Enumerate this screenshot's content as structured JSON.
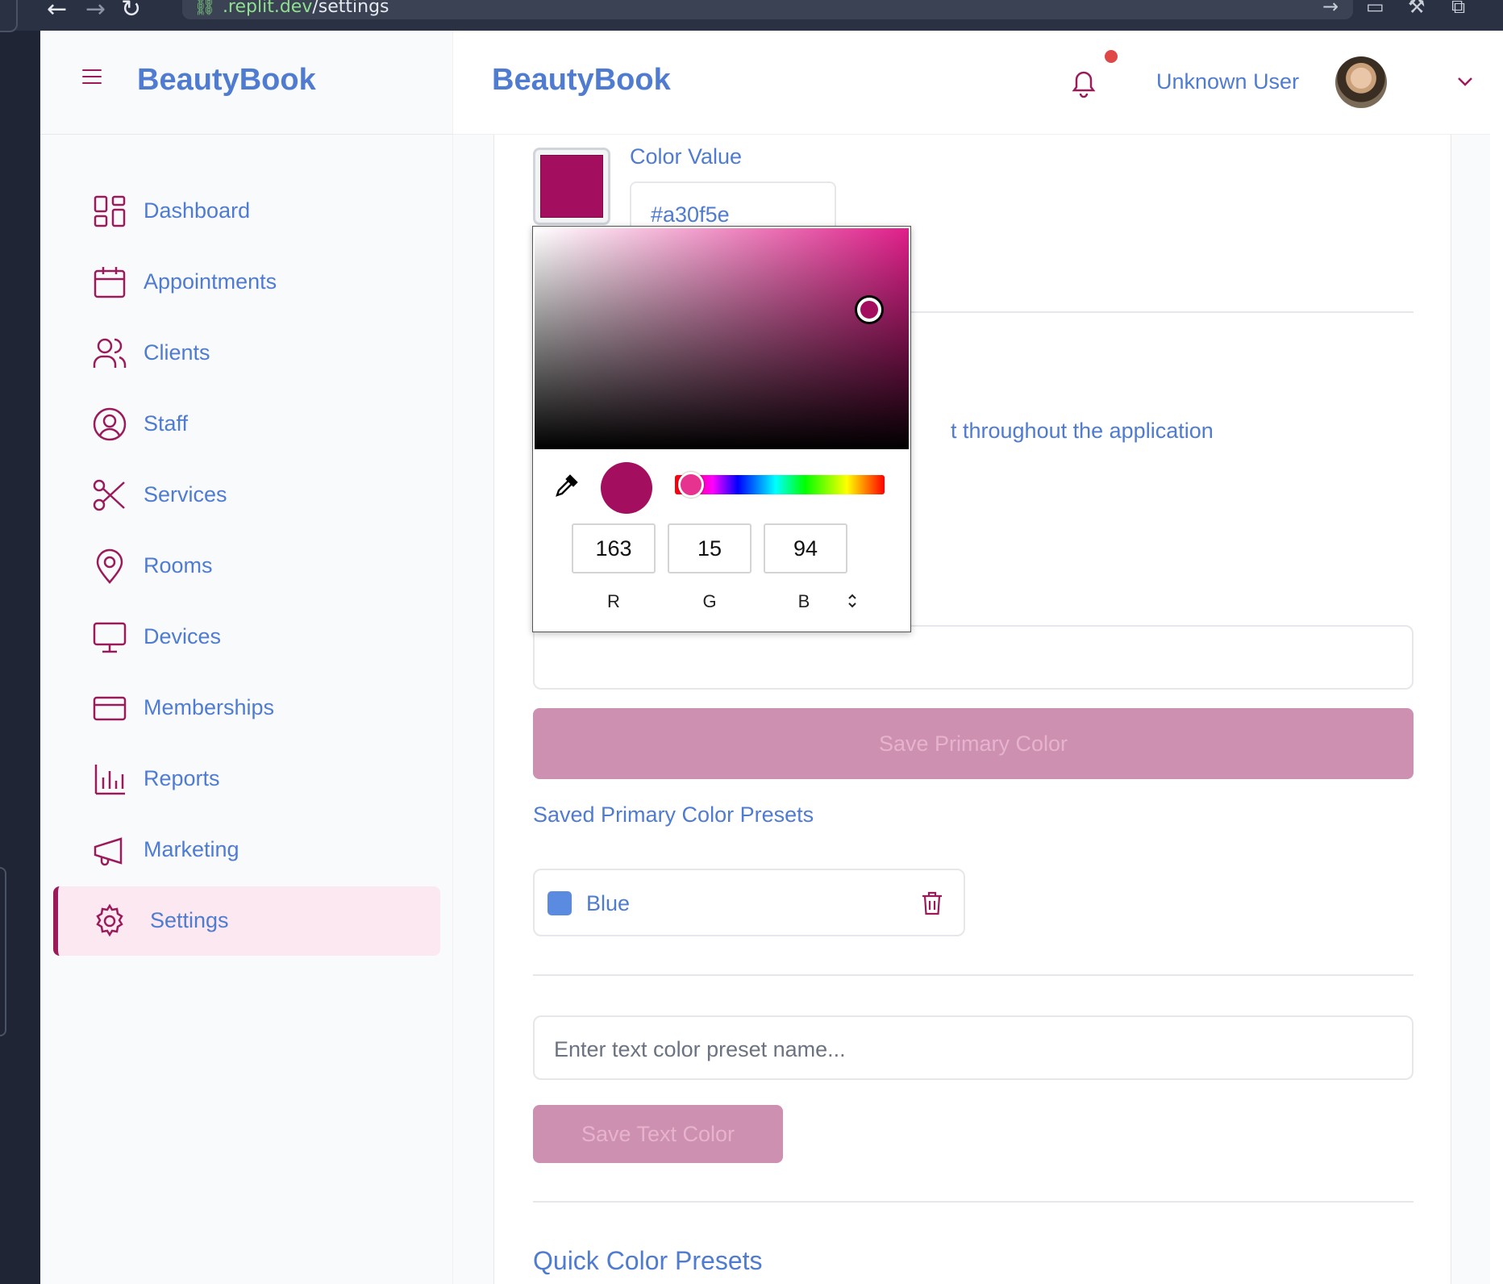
{
  "browser": {
    "url_host": ".replit.dev",
    "url_path": "/settings"
  },
  "sidebar": {
    "brand": "BeautyBook",
    "items": [
      {
        "label": "Dashboard",
        "icon": "dashboard-icon"
      },
      {
        "label": "Appointments",
        "icon": "calendar-icon"
      },
      {
        "label": "Clients",
        "icon": "users-icon"
      },
      {
        "label": "Staff",
        "icon": "user-circle-icon"
      },
      {
        "label": "Services",
        "icon": "scissors-icon"
      },
      {
        "label": "Rooms",
        "icon": "map-pin-icon"
      },
      {
        "label": "Devices",
        "icon": "monitor-icon"
      },
      {
        "label": "Memberships",
        "icon": "credit-card-icon"
      },
      {
        "label": "Reports",
        "icon": "bar-chart-icon"
      },
      {
        "label": "Marketing",
        "icon": "megaphone-icon"
      },
      {
        "label": "Settings",
        "icon": "gear-icon",
        "active": true
      }
    ]
  },
  "header": {
    "brand": "BeautyBook",
    "username": "Unknown User",
    "has_notification": true
  },
  "settings": {
    "color_value_label": "Color Value",
    "color_value": "#a30f5e",
    "description_visible": "t throughout the application",
    "save_primary_label": "Save Primary Color",
    "saved_presets_title": "Saved Primary Color Presets",
    "presets": [
      {
        "name": "Blue",
        "color": "#5b8be0"
      }
    ],
    "text_preset_placeholder": "Enter text color preset name...",
    "save_text_label": "Save Text Color",
    "quick_presets_title": "Quick Color Presets",
    "quick_presets": [
      "#5b8be0",
      "#8b5cf6",
      "#ec4899",
      "#10b981",
      "#9b1b5a",
      "#ef4444"
    ]
  },
  "color_picker": {
    "r": "163",
    "g": "15",
    "b": "94",
    "r_label": "R",
    "g_label": "G",
    "b_label": "B",
    "selected_color": "#a30f5e"
  },
  "colors": {
    "brand_blue": "#4f7bd1",
    "accent": "#9b1b5a",
    "button_disabled": "#cd90b0"
  }
}
